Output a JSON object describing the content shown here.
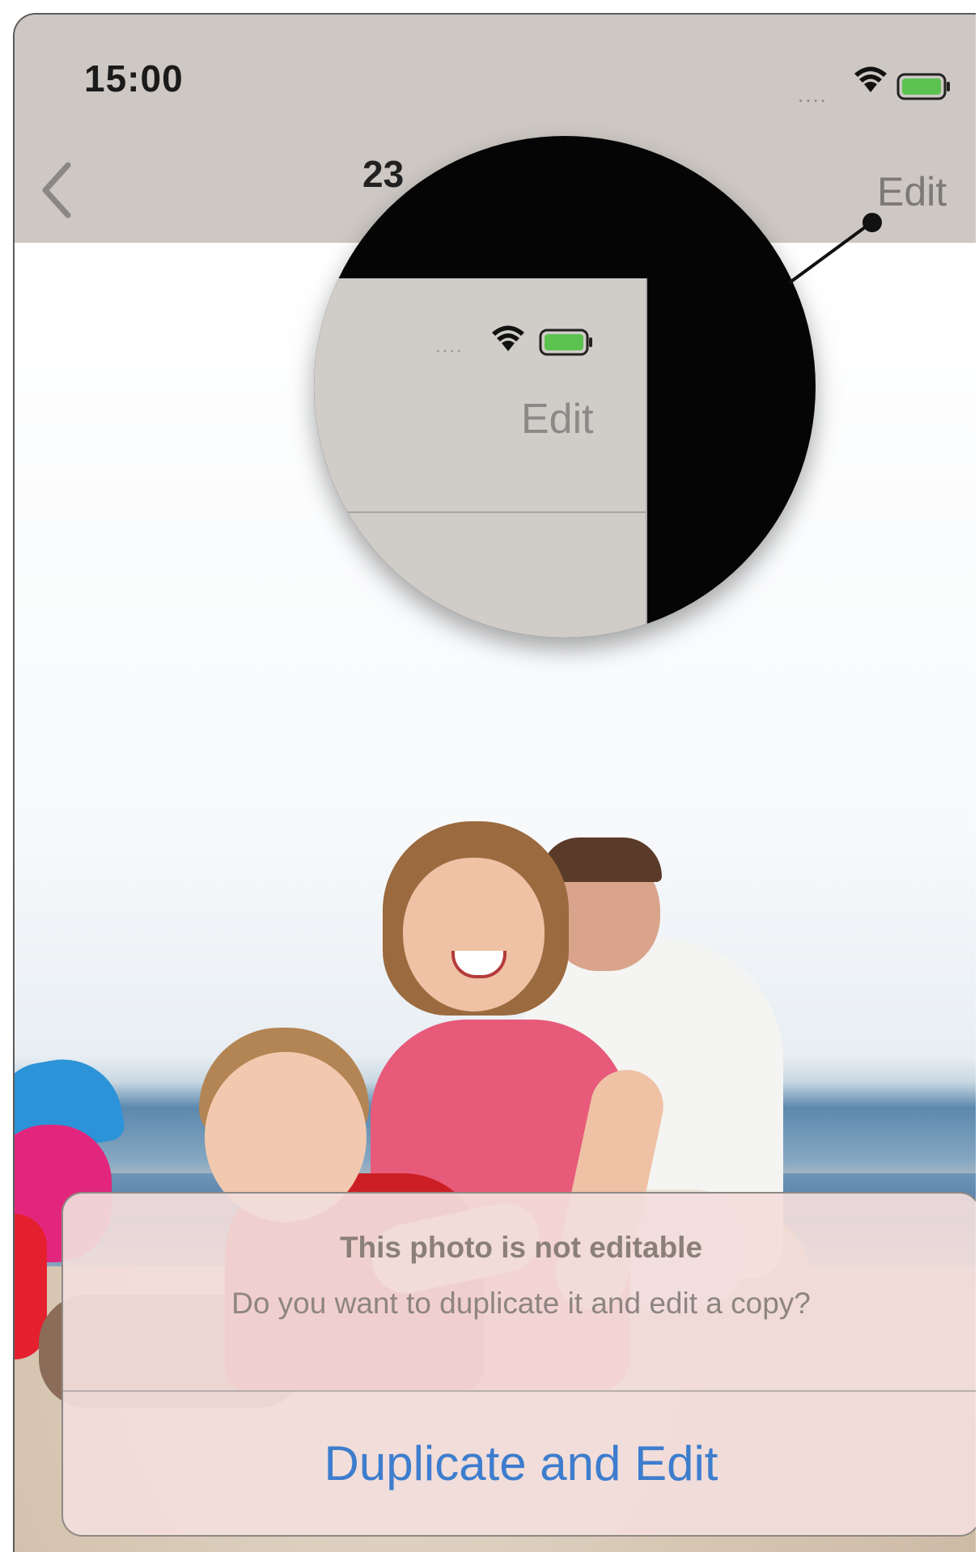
{
  "status_bar": {
    "time": "15:00",
    "signal": "....",
    "wifi_icon": "wifi-icon",
    "battery_icon": "battery-icon",
    "battery_color": "#5cc24f"
  },
  "nav_bar": {
    "back_icon": "chevron-left-icon",
    "title": "23",
    "edit_label": "Edit"
  },
  "magnifier": {
    "signal": "....",
    "edit_label": "Edit"
  },
  "alert": {
    "title": "This photo is not editable",
    "message": "Do you want to duplicate it and edit a copy?",
    "button_label": "Duplicate and Edit",
    "button_color": "#3d7dce"
  }
}
